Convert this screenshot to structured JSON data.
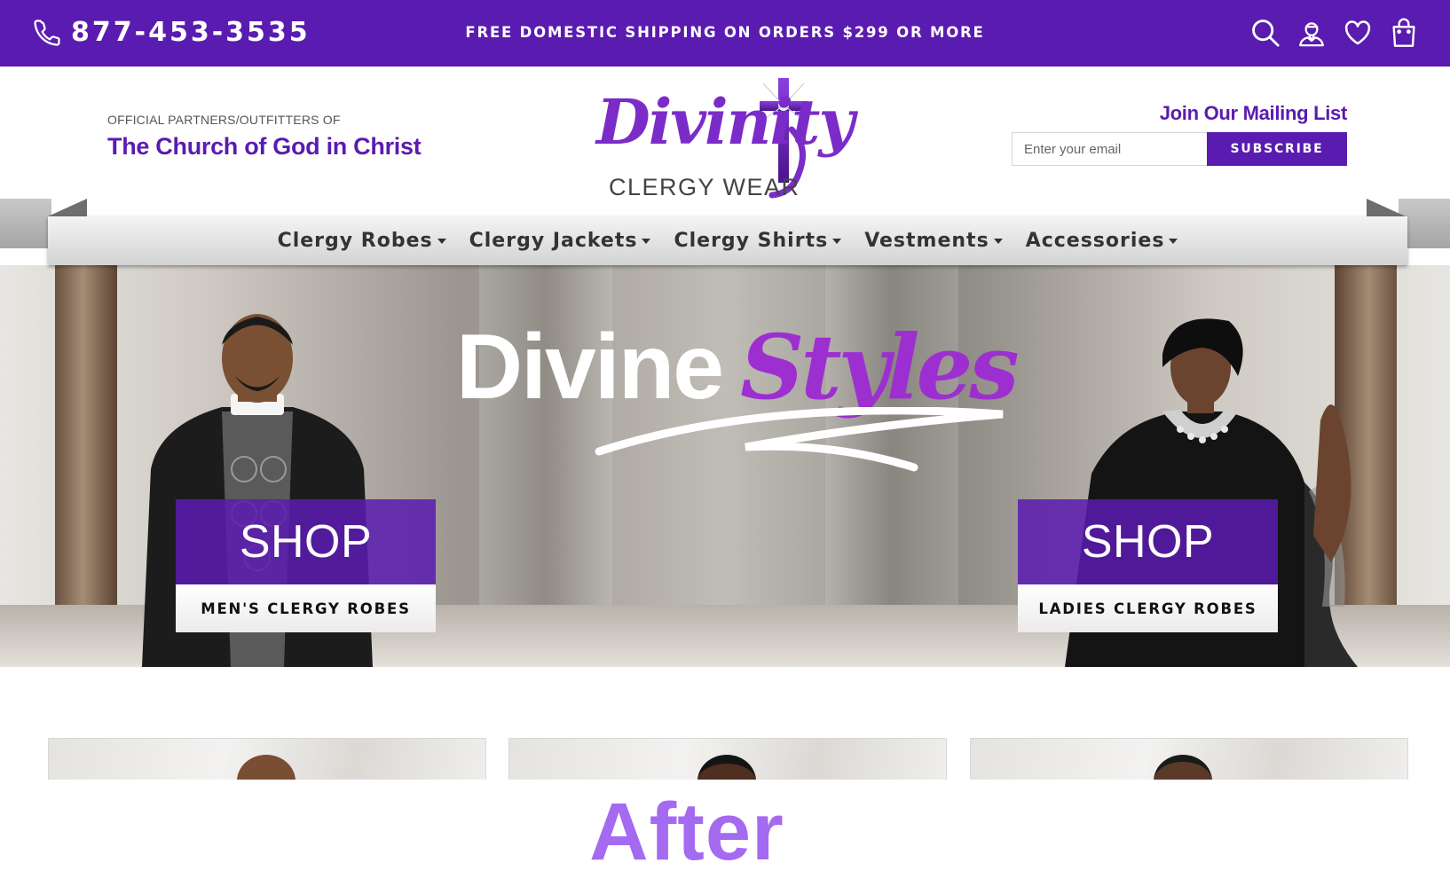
{
  "colors": {
    "brand_purple": "#5a1bb0",
    "accent_purple": "#9d2fd1",
    "after_purple": "#a46af0"
  },
  "topbar": {
    "phone": "877-453-3535",
    "promo": "FREE DOMESTIC SHIPPING ON ORDERS $299 OR MORE",
    "icons": [
      "search-icon",
      "account-icon",
      "wishlist-icon",
      "cart-icon"
    ]
  },
  "header": {
    "partner_label": "OFFICIAL PARTNERS/OUTFITTERS OF",
    "partner_name": "The Church of God in Christ",
    "logo": {
      "wordmark": "Divinity",
      "subtitle": "CLERGY WEAR"
    },
    "mailing": {
      "title": "Join Our Mailing List",
      "placeholder": "Enter your email",
      "button": "SUBSCRIBE"
    }
  },
  "nav": {
    "items": [
      {
        "label": "Clergy Robes"
      },
      {
        "label": "Clergy Jackets"
      },
      {
        "label": "Clergy Shirts"
      },
      {
        "label": "Vestments"
      },
      {
        "label": "Accessories"
      }
    ]
  },
  "hero": {
    "title_plain": "Divine",
    "title_script": "Styles",
    "cta_men": {
      "shop": "SHOP",
      "label": "MEN'S CLERGY ROBES"
    },
    "cta_ladies": {
      "shop": "SHOP",
      "label": "LADIES CLERGY ROBES"
    }
  },
  "footer_overlay": {
    "label": "After"
  }
}
